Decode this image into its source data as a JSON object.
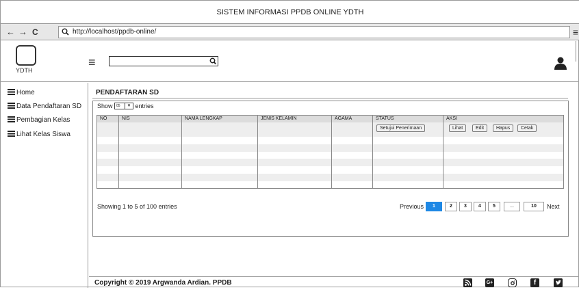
{
  "browser": {
    "title": "SISTEM INFORMASI PPDB ONLINE YDTH",
    "url": "http://localhost/ppdb-online/"
  },
  "header": {
    "logo_text": "YDTH",
    "search_value": ""
  },
  "sidebar": {
    "items": [
      {
        "label": "Home"
      },
      {
        "label": "Data Pendaftaran SD"
      },
      {
        "label": "Pembagian Kelas"
      },
      {
        "label": "Lihat Kelas Siswa"
      }
    ]
  },
  "main": {
    "title": "PENDAFTARAN SD",
    "show_label": "Show",
    "show_value": "05",
    "entries_label": "entries",
    "columns": [
      "NO",
      "NIS",
      "NAMA LENGKAP",
      "JENIS KELAMIN",
      "AGAMA",
      "STATUS",
      "AKSI"
    ],
    "status_button": "Setujui Penerimaan",
    "action_buttons": [
      "Lihat",
      "Edit",
      "Hapus",
      "Cetak"
    ],
    "info": "Showing 1 to 5 of 100 entries",
    "pager": {
      "previous": "Previous",
      "pages": [
        "1",
        "2",
        "3",
        "4",
        "5",
        "...",
        "10"
      ],
      "next": "Next"
    }
  },
  "footer": {
    "copyright": "Copyright © 2019 Argwanda Ardian. PPDB"
  }
}
